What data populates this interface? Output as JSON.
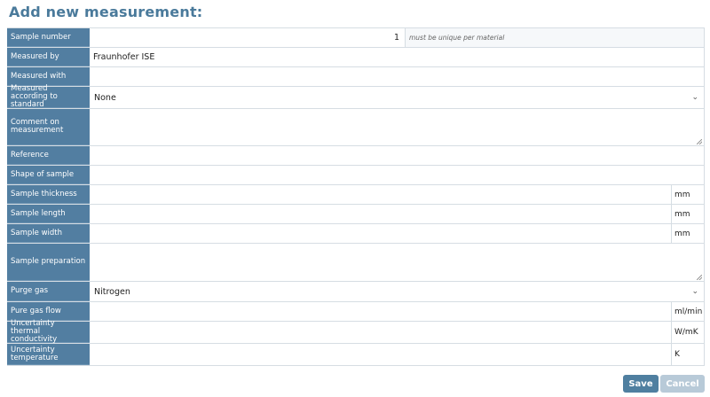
{
  "page": {
    "title": "Add new measurement:"
  },
  "form": {
    "sample_number": {
      "label": "Sample number",
      "value": "1",
      "hint": "must be unique per material"
    },
    "measured_by": {
      "label": "Measured by",
      "value": "Fraunhofer ISE"
    },
    "measured_with": {
      "label": "Measured with",
      "value": ""
    },
    "standard": {
      "label": "Measured according to standard",
      "value": "None"
    },
    "comment": {
      "label": "Comment on measurement",
      "value": ""
    },
    "reference": {
      "label": "Reference",
      "value": ""
    },
    "shape": {
      "label": "Shape of sample",
      "value": ""
    },
    "thickness": {
      "label": "Sample thickness",
      "value": "",
      "unit": "mm"
    },
    "length": {
      "label": "Sample length",
      "value": "",
      "unit": "mm"
    },
    "width": {
      "label": "Sample width",
      "value": "",
      "unit": "mm"
    },
    "preparation": {
      "label": "Sample preparation",
      "value": ""
    },
    "purge_gas": {
      "label": "Purge gas",
      "value": "Nitrogen"
    },
    "gas_flow": {
      "label": "Pure gas flow",
      "value": "",
      "unit": "ml/min"
    },
    "uncertainty_tc": {
      "label": "Uncertainty thermal conductivity",
      "value": "",
      "unit": "W/mK"
    },
    "uncertainty_temp": {
      "label": "Uncertainty temperature",
      "value": "",
      "unit": "K"
    }
  },
  "actions": {
    "save": "Save",
    "cancel": "Cancel"
  },
  "icons": {
    "dropdown": "chevron-down-icon",
    "resize": "resize-grip-icon"
  },
  "colors": {
    "label_bg": "#527ea1",
    "title": "#4a7a9b",
    "save_bg": "#4f7fa0",
    "cancel_bg": "#b8cad8"
  }
}
